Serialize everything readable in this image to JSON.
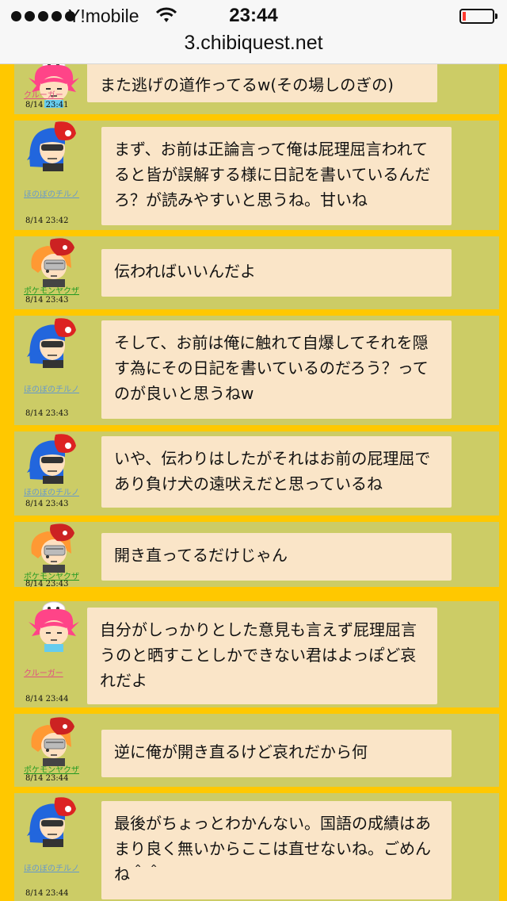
{
  "status_bar": {
    "carrier": "Y!mobile",
    "time": "23:44",
    "battery_level": 0.12
  },
  "address_bar": {
    "url": "3.chibiquest.net"
  },
  "colors": {
    "page_background": "#ffc800",
    "post_background": "#cccc66",
    "bubble_background": "#fae5c8",
    "name_krooger": "#e05080",
    "name_honobono": "#6699cc",
    "name_pokemon": "#229922"
  },
  "messages": [
    {
      "user": "クルーガー",
      "avatar": "pink-hair-avatar",
      "timestamp": "8/14 23:41",
      "text": "また逃げの道作ってるw(その場しのぎの)"
    },
    {
      "user": "ほのぼのチルノ",
      "avatar": "blue-hair-avatar",
      "timestamp": "8/14 23:42",
      "text": "まず、お前は正論言って俺は屁理屈言われてると皆が誤解する様に日記を書いているんだろ？が読みやすいと思うね。甘いね"
    },
    {
      "user": "ポケモンヤクザ",
      "avatar": "orange-hair-avatar",
      "timestamp": "8/14 23:43",
      "text": "伝わればいいんだよ"
    },
    {
      "user": "ほのぼのチルノ",
      "avatar": "blue-hair-avatar",
      "timestamp": "8/14 23:43",
      "text": "そして、お前は俺に触れて自爆してそれを隠す為にその日記を書いているのだろう？ってのが良いと思うねw"
    },
    {
      "user": "ほのぼのチルノ",
      "avatar": "blue-hair-avatar",
      "timestamp": "8/14 23:43",
      "text": "いや、伝わりはしたがそれはお前の屁理屈であり負け犬の遠吠えだと思っているね"
    },
    {
      "user": "ポケモンヤクザ",
      "avatar": "orange-hair-avatar",
      "timestamp": "8/14 23:43",
      "text": "開き直ってるだけじゃん"
    },
    {
      "user": "クルーガー",
      "avatar": "pink-hair-avatar",
      "timestamp": "8/14 23:44",
      "text": "自分がしっかりとした意見も言えず屁理屈言うのと晒すことしかできない君はよっぽど哀れだよ"
    },
    {
      "user": "ポケモンヤクザ",
      "avatar": "orange-hair-avatar",
      "timestamp": "8/14 23:44",
      "text": "逆に俺が開き直るけど哀れだから何"
    },
    {
      "user": "ほのぼのチルノ",
      "avatar": "blue-hair-avatar",
      "timestamp": "8/14 23:44",
      "text": "最後がちょっとわかんない。国語の成績はあまり良く無いからここは直せないね。ごめんね＾＾"
    }
  ]
}
